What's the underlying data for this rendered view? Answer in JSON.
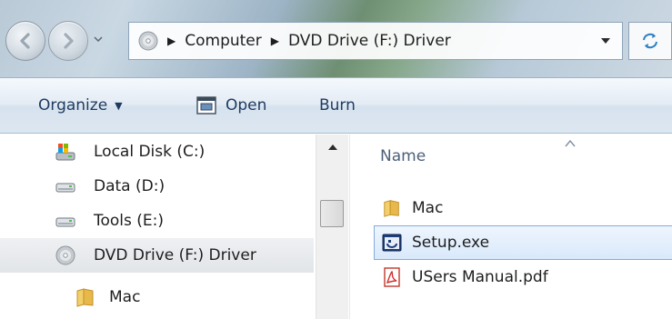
{
  "address": {
    "crumbs": [
      "Computer",
      "DVD Drive (F:) Driver"
    ]
  },
  "toolbar": {
    "organize_label": "Organize",
    "open_label": "Open",
    "burn_label": "Burn"
  },
  "nav": {
    "items": [
      {
        "label": "Local Disk (C:)",
        "icon": "local-disk-icon"
      },
      {
        "label": "Data (D:)",
        "icon": "drive-icon"
      },
      {
        "label": "Tools (E:)",
        "icon": "drive-icon"
      },
      {
        "label": "DVD Drive (F:) Driver",
        "icon": "dvd-drive-icon",
        "selected": true
      },
      {
        "label": "Mac",
        "icon": "folder-icon"
      }
    ]
  },
  "files": {
    "column_name": "Name",
    "items": [
      {
        "label": "Mac",
        "icon": "folder-icon"
      },
      {
        "label": "Setup.exe",
        "icon": "setup-exe-icon",
        "selected": true
      },
      {
        "label": "USers Manual.pdf",
        "icon": "pdf-icon"
      }
    ]
  },
  "colors": {
    "selection_border": "#84acdd",
    "command_text": "#1e3a5f",
    "folder": "#e8b84a"
  }
}
